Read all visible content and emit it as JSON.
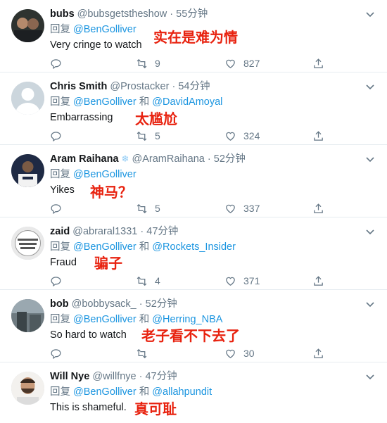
{
  "tweets": [
    {
      "name": "bubs",
      "handle": "@bubsgetsthe­show",
      "time": "55分钟",
      "reply_prefix": "回复",
      "mentions": "@BenGolliver",
      "mentions2": "",
      "joiner": "",
      "text": "Very cringe to watch",
      "note": "实在是难为情",
      "retweets": "9",
      "likes": "827",
      "avatar": "photo-dark",
      "verified": ""
    },
    {
      "name": "Chris Smith",
      "handle": "@Prostacker",
      "time": "54分钟",
      "reply_prefix": "回复",
      "mentions": "@BenGolliver",
      "joiner": "和",
      "mentions2": "@DavidAmoyal",
      "text": "Embarrassing",
      "note": "太尴尬",
      "retweets": "5",
      "likes": "324",
      "avatar": "default-silhouette",
      "verified": ""
    },
    {
      "name": "Aram Raihana",
      "handle": "@AramRaihana",
      "time": "52分钟",
      "reply_prefix": "回复",
      "mentions": "@BenGolliver",
      "mentions2": "",
      "joiner": "",
      "text": "Yikes",
      "note": "神马？",
      "retweets": "5",
      "likes": "337",
      "avatar": "photo-jersey",
      "verified": "❄"
    },
    {
      "name": "zaid",
      "handle": "@abraral1331",
      "time": "47分钟",
      "reply_prefix": "回复",
      "mentions": "@BenGolliver",
      "joiner": "和",
      "mentions2": "@Rockets_Insider",
      "text": "Fraud",
      "note": "骗子",
      "retweets": "4",
      "likes": "371",
      "avatar": "photo-badge",
      "verified": ""
    },
    {
      "name": "bob",
      "handle": "@bobbysack_",
      "time": "52分钟",
      "reply_prefix": "回复",
      "mentions": "@BenGolliver",
      "joiner": "和",
      "mentions2": "@Herring_NBA",
      "text": "So hard to watch",
      "note": "老子看不下去了",
      "retweets": "",
      "likes": "30",
      "avatar": "photo-building",
      "verified": ""
    },
    {
      "name": "Will Nye",
      "handle": "@willfnye",
      "time": "47分钟",
      "reply_prefix": "回复",
      "mentions": "@BenGolliver",
      "joiner": "和",
      "mentions2": "@allahpundit",
      "text": "This is shameful.",
      "note": "真可耻",
      "retweets": "",
      "likes": "",
      "avatar": "photo-face",
      "verified": ""
    }
  ],
  "icons": {
    "caret": "chevron-down-icon",
    "reply": "reply-icon",
    "retweet": "retweet-icon",
    "like": "heart-icon",
    "share": "share-icon"
  },
  "colors": {
    "mention": "#1b95e0",
    "note": "#e8220f",
    "muted": "#657786",
    "divider": "#e6ecf0"
  }
}
